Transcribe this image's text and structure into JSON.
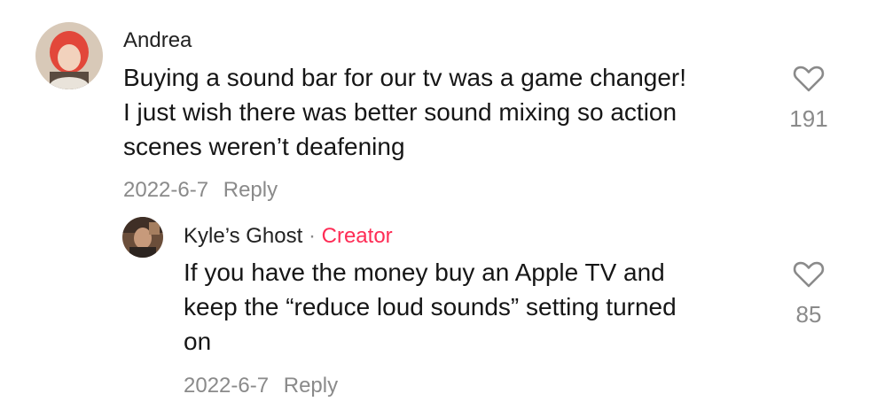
{
  "comment": {
    "username": "Andrea",
    "text_lines": [
      "Buying a sound bar for our tv was a game changer!",
      "I just wish there was better sound mixing so action",
      "scenes weren’t deafening"
    ],
    "date": "2022-6-7",
    "reply_label": "Reply",
    "like_count": "191"
  },
  "reply": {
    "username": "Kyle’s Ghost",
    "separator": " · ",
    "badge": "Creator",
    "text_lines": [
      "If you have the money buy an Apple TV and",
      "keep the “reduce loud sounds” setting turned",
      "on"
    ],
    "date": "2022-6-7",
    "reply_label": "Reply",
    "like_count": "85"
  },
  "colors": {
    "creator_badge": "#fe2c55",
    "meta_text": "#8a8a8a"
  },
  "icons": {
    "like": "heart-outline-icon"
  }
}
